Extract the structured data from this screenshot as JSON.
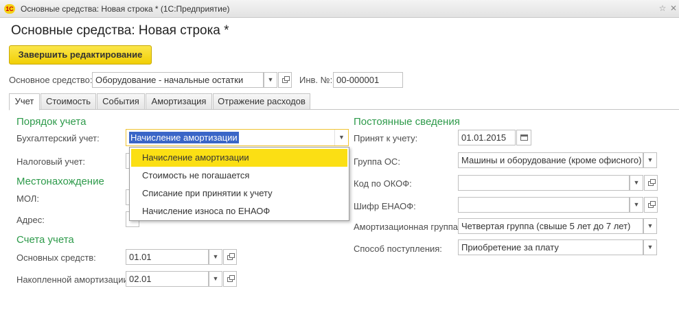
{
  "window": {
    "title": "Основные средства: Новая строка * (1С:Предприятие)",
    "logo": "1С"
  },
  "form": {
    "title": "Основные средства: Новая строка *",
    "finish_button": "Завершить редактирование"
  },
  "header": {
    "asset_label": "Основное средство:",
    "asset_value": "Оборудование  - начальные остатки",
    "inv_label": "Инв. №:",
    "inv_value": "00-000001"
  },
  "tabs": [
    {
      "label": "Учет",
      "active": true
    },
    {
      "label": "Стоимость",
      "active": false
    },
    {
      "label": "События",
      "active": false
    },
    {
      "label": "Амортизация",
      "active": false
    },
    {
      "label": "Отражение расходов",
      "active": false
    }
  ],
  "left": {
    "accounting_order": {
      "title": "Порядок учета",
      "buh_label": "Бухгалтерский учет:",
      "buh_value": "Начисление амортизации",
      "tax_label": "Налоговый учет:"
    },
    "location": {
      "title": "Местонахождение",
      "mol_label": "МОЛ:",
      "address_label": "Адрес:"
    },
    "accounts": {
      "title": "Счета учета",
      "fixed_assets_label": "Основных средств:",
      "fixed_assets_value": "01.01",
      "depreciation_label": "Накопленной амортизации:",
      "depreciation_value": "02.01"
    }
  },
  "dropdown": {
    "items": [
      "Начисление амортизации",
      "Стоимость не погашается",
      "Списание при принятии к учету",
      "Начисление износа по ЕНАОФ"
    ],
    "highlighted": 0
  },
  "right": {
    "title": "Постоянные сведения",
    "accepted_label": "Принят к учету:",
    "accepted_value": "01.01.2015",
    "group_label": "Группа ОС:",
    "group_value": "Машины и оборудование (кроме офисного)",
    "okof_label": "Код по ОКОФ:",
    "okof_value": "",
    "enaof_label": "Шифр ЕНАОФ:",
    "enaof_value": "",
    "amort_group_label": "Амортизационная группа:",
    "amort_group_value": "Четвертая группа (свыше 5 лет до 7 лет)",
    "receipt_label": "Способ поступления:",
    "receipt_value": "Приобретение за плату"
  },
  "colors": {
    "section_green": "#2d9a4a",
    "button_yellow": "#f1cf05",
    "selection_blue": "#3a66c7",
    "highlight_yellow": "#fbdf14"
  }
}
